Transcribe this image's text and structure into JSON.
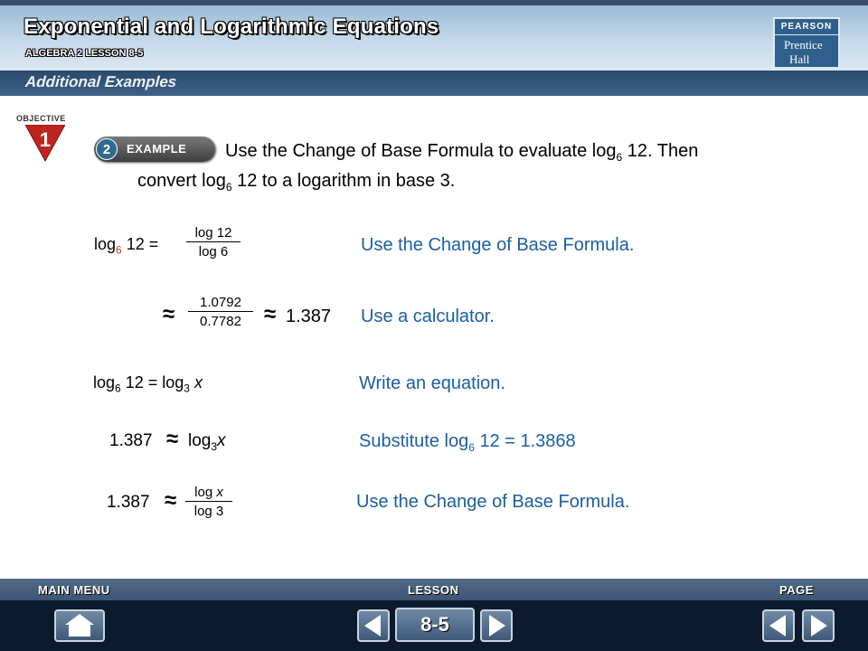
{
  "header": {
    "title": "Exponential and Logarithmic Equations",
    "subtitle": "ALGEBRA 2 LESSON 8-5",
    "logo_top": "PEARSON",
    "logo_line1": "Prentice",
    "logo_line2": "Hall"
  },
  "section": {
    "label": "Additional Examples"
  },
  "objective": {
    "label": "OBJECTIVE",
    "number": "1"
  },
  "example": {
    "number": "2",
    "label": "EXAMPLE",
    "line1_a": "Use the Change of Base Formula to evaluate log",
    "line1_sub": "6",
    "line1_b": " 12. Then",
    "line2_a": "convert log",
    "line2_sub": "6",
    "line2_b": " 12 to a logarithm in base 3."
  },
  "steps": {
    "s1": {
      "lhs": "log",
      "lhs_sub": "6",
      "lhs_b": " 12 =",
      "frac_num": "log 12",
      "frac_den": "log 6",
      "note": "Use the Change of Base Formula."
    },
    "s2": {
      "approx": "≈",
      "frac_num": "1.0792",
      "frac_den": "0.7782",
      "approx2": "≈",
      "value": "1.387",
      "note": "Use a calculator."
    },
    "s3": {
      "text_a": "log",
      "text_sub1": "6",
      "text_b": " 12 = log",
      "text_sub2": "3",
      "text_var": "x",
      "note": "Write an equation."
    },
    "s4": {
      "value": "1.387",
      "approx": "≈",
      "rhs": "log",
      "rhs_sub": "3",
      "rhs_var": "x",
      "note_a": "Substitute log",
      "note_sub": "6",
      "note_b": " 12 = 1.3868"
    },
    "s5": {
      "value": "1.387",
      "approx": "≈",
      "frac_num_a": "log ",
      "frac_num_var": "x",
      "frac_den": "log 3",
      "note": "Use the Change of Base Formula."
    }
  },
  "footer": {
    "main_menu": "MAIN MENU",
    "lesson": "LESSON",
    "page": "PAGE",
    "lesson_number": "8-5"
  }
}
